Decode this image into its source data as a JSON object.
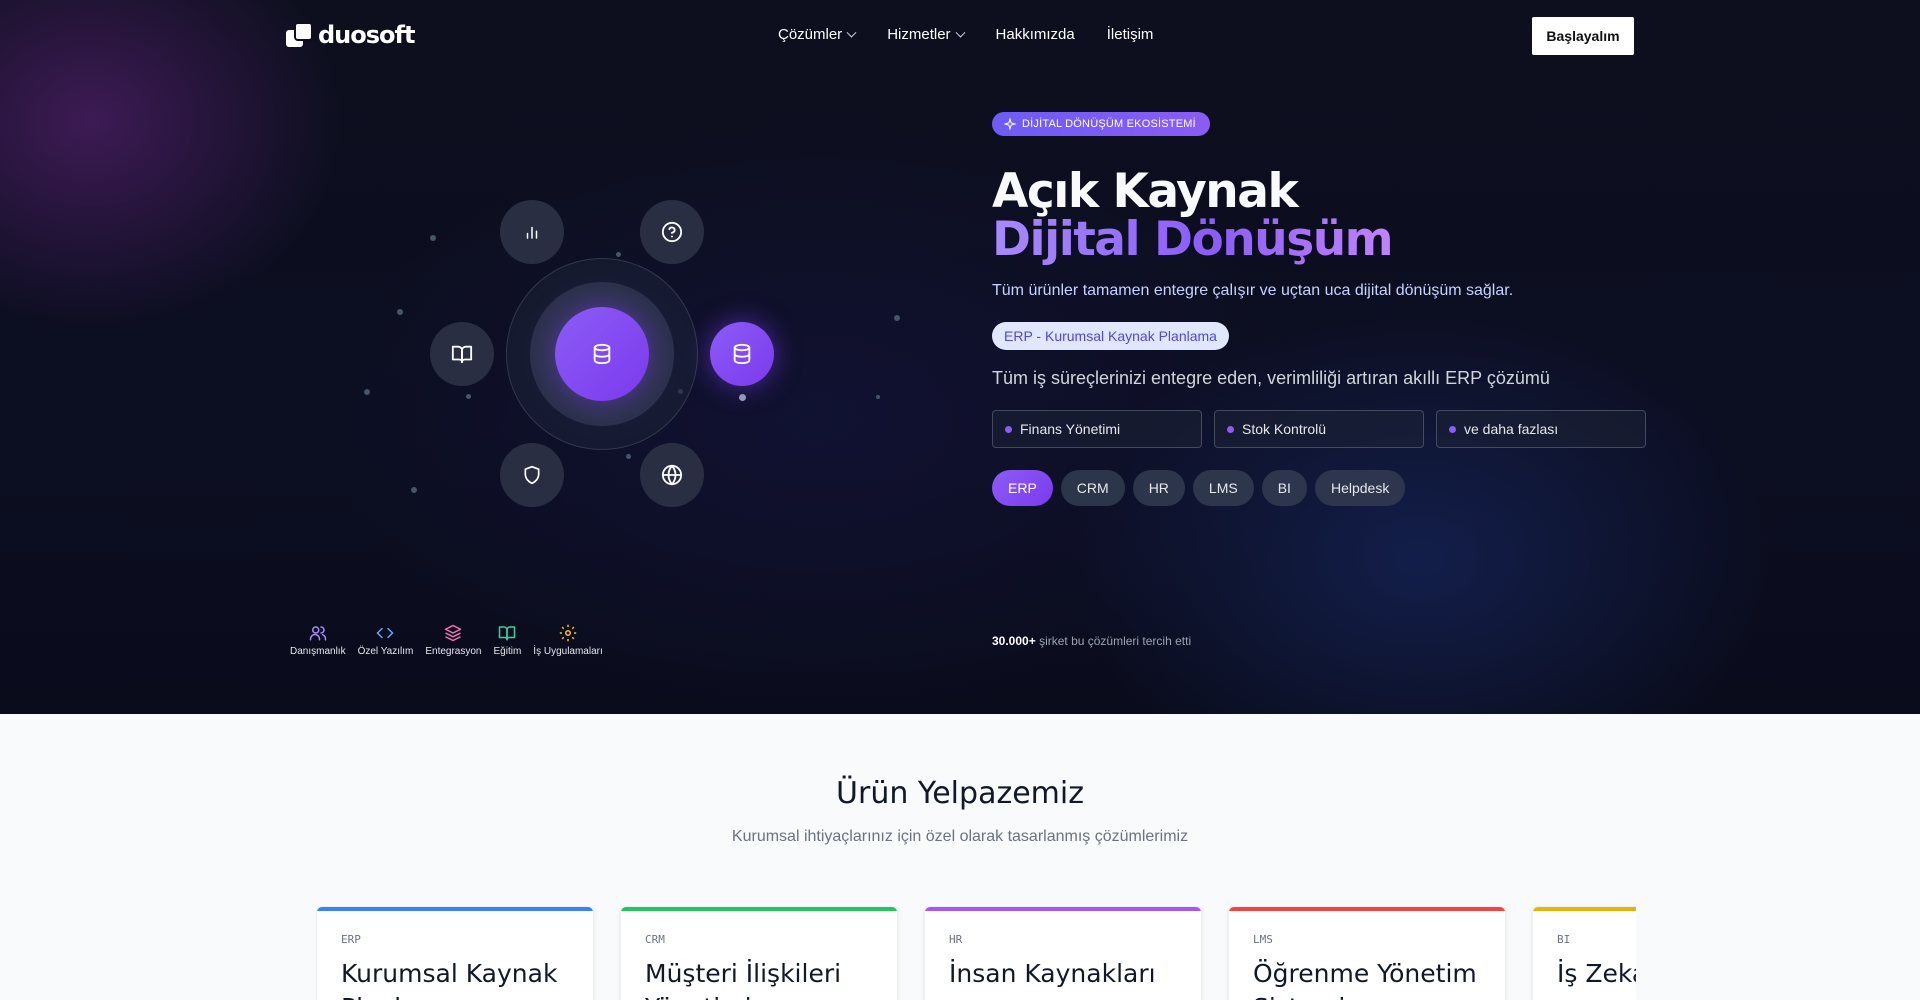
{
  "brand": {
    "name": "duosoft"
  },
  "nav": {
    "items": [
      {
        "label": "Çözümler",
        "dropdown": true
      },
      {
        "label": "Hizmetler",
        "dropdown": true
      },
      {
        "label": "Hakkımızda",
        "dropdown": false
      },
      {
        "label": "İletişim",
        "dropdown": false
      }
    ],
    "cta": "Başlayalım"
  },
  "hero": {
    "badge": "DİJİTAL DÖNÜŞÜM EKOSİSTEMİ",
    "title_line1": "Açık Kaynak",
    "title_line2": "Dijital Dönüşüm",
    "lead": "Tüm ürünler tamamen entegre çalışır ve uçtan uca dijital dönüşüm sağlar.",
    "product_pill": "ERP - Kurumsal Kaynak Planlama",
    "product_desc": "Tüm iş süreçlerinizi entegre eden, verimliliği artıran akıllı ERP çözümü",
    "features": [
      "Finans Yönetimi",
      "Stok Kontrolü",
      "ve daha fazlası"
    ],
    "tabs": [
      "ERP",
      "CRM",
      "HR",
      "LMS",
      "BI",
      "Helpdesk"
    ],
    "active_tab": "ERP",
    "social_count": "30.000+",
    "social_text": "şirket bu çözümleri tercih etti"
  },
  "orbit": {
    "satellites": [
      "bar-chart-icon",
      "help-circle-icon",
      "book-open-icon",
      "database-icon",
      "shield-icon",
      "globe-icon"
    ],
    "core_icon": "database-icon"
  },
  "services": [
    {
      "label": "Danışmanlık",
      "icon": "users-icon",
      "color": "#a78bfa"
    },
    {
      "label": "Özel Yazılım",
      "icon": "code-icon",
      "color": "#60a5fa"
    },
    {
      "label": "Entegrasyon",
      "icon": "layers-icon",
      "color": "#f472b6"
    },
    {
      "label": "Eğitim",
      "icon": "book-open-icon",
      "color": "#34d399"
    },
    {
      "label": "İş Uygulamaları",
      "icon": "settings-icon",
      "color": "#fbbf24"
    }
  ],
  "products_section": {
    "title": "Ürün Yelpazemiz",
    "subtitle": "Kurumsal ihtiyaçlarınız için özel olarak tasarlanmış çözümlerimiz",
    "cards": [
      {
        "code": "ERP",
        "name": "Kurumsal Kaynak Planlaması",
        "color": "#3b82f6"
      },
      {
        "code": "CRM",
        "name": "Müşteri İlişkileri Yönetimi",
        "color": "#22c55e"
      },
      {
        "code": "HR",
        "name": "İnsan Kaynakları",
        "color": "#a855f7"
      },
      {
        "code": "LMS",
        "name": "Öğrenme Yönetim Sistemi",
        "color": "#ef4444"
      },
      {
        "code": "BI",
        "name": "İş Zekası",
        "color": "#eab308"
      }
    ]
  }
}
